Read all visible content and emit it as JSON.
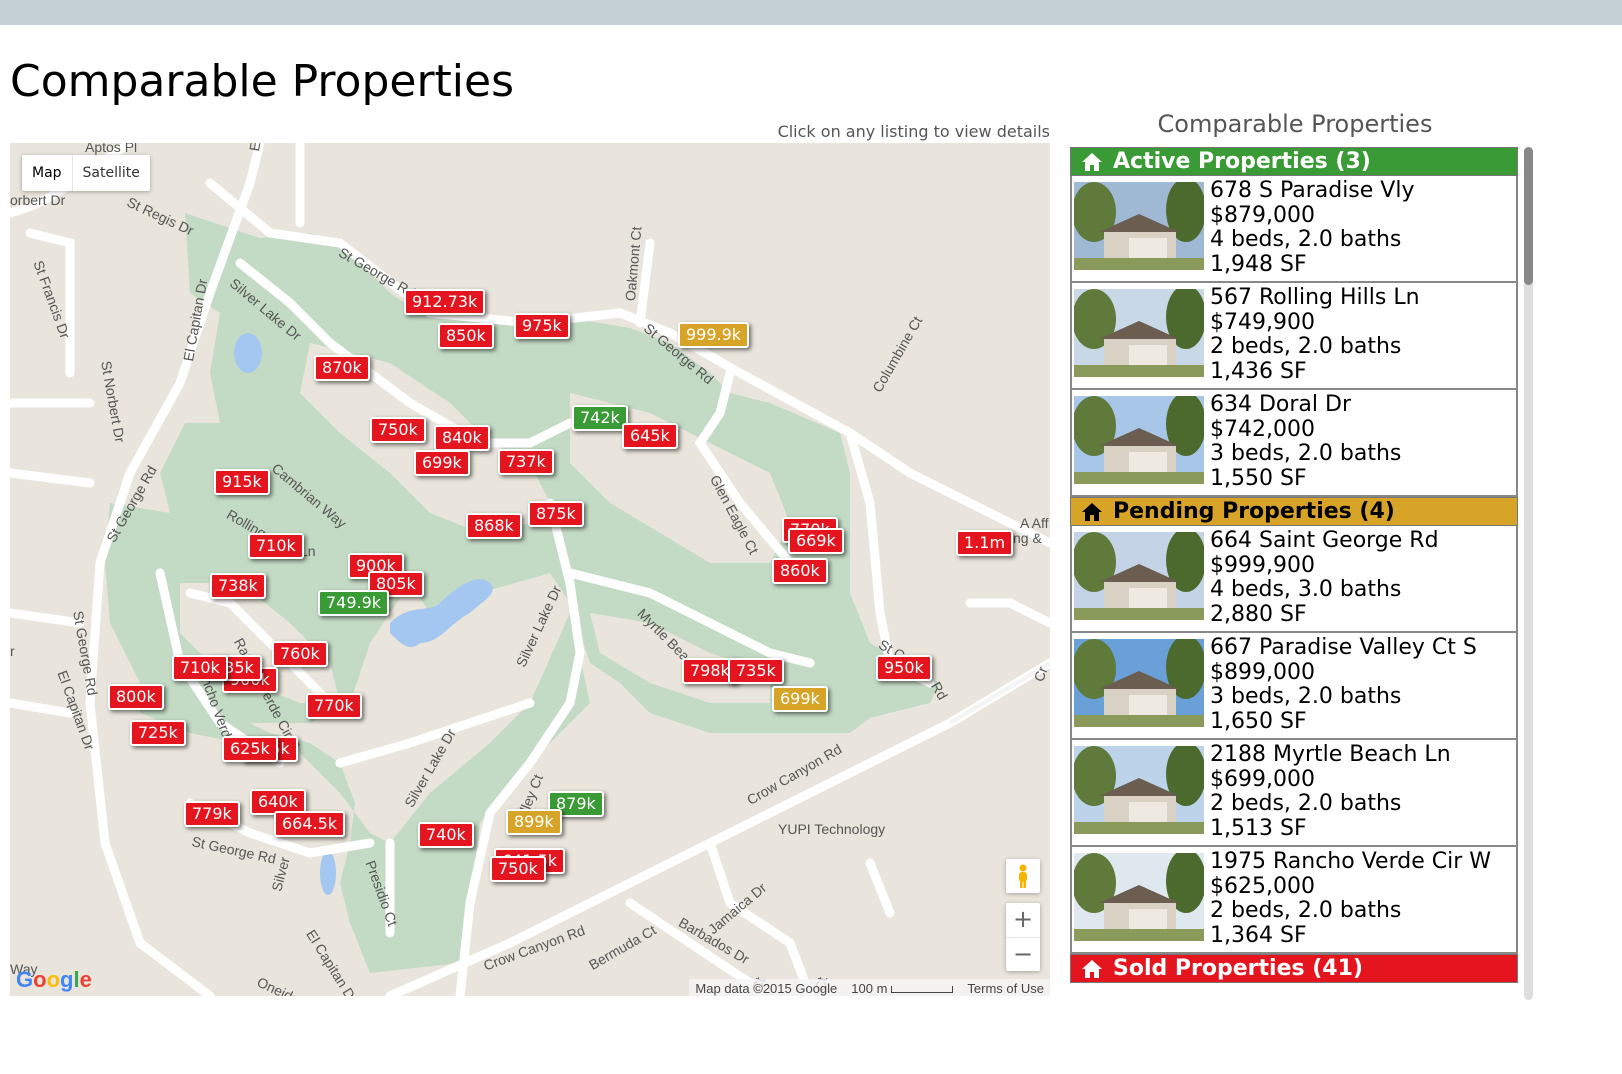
{
  "page": {
    "title": "Comparable Properties"
  },
  "map": {
    "hint": "Click on any listing to view details",
    "controls": {
      "map": "Map",
      "satellite": "Satellite",
      "zoom_in": "+",
      "zoom_out": "−"
    },
    "logo": "Google",
    "attribution": {
      "data": "Map data ©2015 Google",
      "scale": "100 m",
      "terms": "Terms of Use"
    },
    "streets": [
      "Aptos Pl",
      "El Ca",
      "orbert Dr",
      "St Regis Dr",
      "St Francis Dr",
      "St George Rd",
      "Oakmont Ct",
      "St George Rd",
      "Silver Lake Dr",
      "El Capitan Dr",
      "St Norbert Dr",
      "Columbine Ct",
      "Do",
      "Cambrian Way",
      "Rolling Hills",
      "Ln",
      "Glen Eagle Ct",
      "A Aff",
      "ting &",
      "St George Rd",
      "Myrtle Beach",
      "Silver Lake Dr",
      "St George Rd",
      "El Capitan Dr",
      "Rancho Verde Cir E",
      "Rancho Verde",
      "St C",
      "Rd",
      "Crow Canyon Rd",
      "Silver Lake Dr",
      "Valley Ct",
      "YUPI Technology",
      "St George Rd",
      "Silver",
      "Presidio Ct",
      "Jamaica Dr",
      "El Capitan Dr",
      "Crow Canyon Rd",
      "Bermuda Ct",
      "Barbados Dr",
      "Oneida Cir",
      "Way",
      "Cr",
      "Ct",
      "Ct",
      "r"
    ],
    "markers": [
      {
        "label": "912.73k",
        "status": "sold"
      },
      {
        "label": "975k",
        "status": "sold"
      },
      {
        "label": "850k",
        "status": "sold"
      },
      {
        "label": "999.9k",
        "status": "pending"
      },
      {
        "label": "870k",
        "status": "sold"
      },
      {
        "label": "742k",
        "status": "active"
      },
      {
        "label": "645k",
        "status": "sold"
      },
      {
        "label": "750k",
        "status": "sold"
      },
      {
        "label": "840k",
        "status": "sold"
      },
      {
        "label": "699k",
        "status": "sold"
      },
      {
        "label": "737k",
        "status": "sold"
      },
      {
        "label": "915k",
        "status": "sold"
      },
      {
        "label": "868k",
        "status": "sold"
      },
      {
        "label": "875k",
        "status": "sold"
      },
      {
        "label": "770k",
        "status": "sold"
      },
      {
        "label": "669k",
        "status": "sold"
      },
      {
        "label": "1.1m",
        "status": "sold"
      },
      {
        "label": "710k",
        "status": "sold"
      },
      {
        "label": "900k",
        "status": "sold"
      },
      {
        "label": "860k",
        "status": "sold"
      },
      {
        "label": "738k",
        "status": "sold"
      },
      {
        "label": "805k",
        "status": "sold"
      },
      {
        "label": "749.9k",
        "status": "active"
      },
      {
        "label": "760k",
        "status": "sold"
      },
      {
        "label": "900k",
        "status": "sold"
      },
      {
        "label": "735k",
        "status": "sold"
      },
      {
        "label": "710k",
        "status": "sold"
      },
      {
        "label": "798k",
        "status": "sold"
      },
      {
        "label": "735k",
        "status": "sold"
      },
      {
        "label": "950k",
        "status": "sold"
      },
      {
        "label": "800k",
        "status": "sold"
      },
      {
        "label": "699k",
        "status": "pending"
      },
      {
        "label": "770k",
        "status": "sold"
      },
      {
        "label": "725k",
        "status": "sold"
      },
      {
        "label": "665k",
        "status": "sold"
      },
      {
        "label": "625k",
        "status": "sold"
      },
      {
        "label": "879k",
        "status": "active"
      },
      {
        "label": "640k",
        "status": "sold"
      },
      {
        "label": "779k",
        "status": "sold"
      },
      {
        "label": "899k",
        "status": "pending"
      },
      {
        "label": "664.5k",
        "status": "sold"
      },
      {
        "label": "740k",
        "status": "sold"
      },
      {
        "label": "641.5k",
        "status": "sold"
      },
      {
        "label": "750k",
        "status": "sold"
      }
    ]
  },
  "sidebar": {
    "title": "Comparable Properties",
    "groups": [
      {
        "label": "Active Properties (3)",
        "status": "active",
        "listings": [
          {
            "address": "678 S Paradise Vly",
            "price": "$879,000",
            "beds": "4 beds, 2.0 baths",
            "sqft": "1,948 SF"
          },
          {
            "address": "567 Rolling Hills Ln",
            "price": "$749,900",
            "beds": "2 beds, 2.0 baths",
            "sqft": "1,436 SF"
          },
          {
            "address": "634 Doral Dr",
            "price": "$742,000",
            "beds": "3 beds, 2.0 baths",
            "sqft": "1,550 SF"
          }
        ]
      },
      {
        "label": "Pending Properties (4)",
        "status": "pending",
        "listings": [
          {
            "address": "664 Saint George Rd",
            "price": "$999,900",
            "beds": "4 beds, 3.0 baths",
            "sqft": "2,880 SF"
          },
          {
            "address": "667 Paradise Valley Ct S",
            "price": "$899,000",
            "beds": "3 beds, 2.0 baths",
            "sqft": "1,650 SF"
          },
          {
            "address": "2188 Myrtle Beach Ln",
            "price": "$699,000",
            "beds": "2 beds, 2.0 baths",
            "sqft": "1,513 SF"
          },
          {
            "address": "1975 Rancho Verde Cir W",
            "price": "$625,000",
            "beds": "2 beds, 2.0 baths",
            "sqft": "1,364 SF"
          }
        ]
      },
      {
        "label": "Sold Properties (41)",
        "status": "sold",
        "listings": []
      }
    ]
  },
  "colors": {
    "active": "#3a9a35",
    "pending": "#d7a428",
    "sold": "#e5151f",
    "park": "#c3dbc5",
    "water": "#a3c7f0",
    "land": "#e9e5dc"
  },
  "icons": {
    "group_header": "home-icon",
    "pegman": "pegman-icon"
  }
}
